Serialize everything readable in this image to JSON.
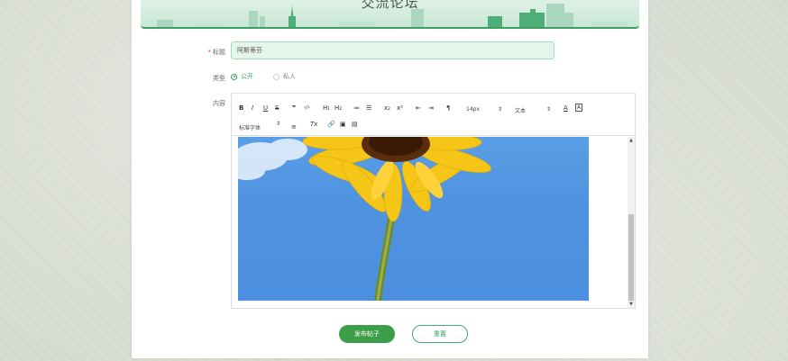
{
  "banner": {
    "title": "交流论坛"
  },
  "form": {
    "title_label": "标题",
    "required_mark": "*",
    "title_value": "阿斯蒂芬",
    "type_label": "类型",
    "type_options": [
      {
        "label": "公开",
        "checked": true
      },
      {
        "label": "私人",
        "checked": false
      }
    ],
    "content_label": "内容"
  },
  "toolbar": {
    "bold": "B",
    "italic": "I",
    "underline": "U",
    "strike": "S",
    "quote": "❞",
    "code": "‹/›",
    "h1": "H₁",
    "h2": "H₂",
    "ol": "≔",
    "ul": "☰",
    "sub": "x₂",
    "sup": "x²",
    "outdent": "⇤",
    "indent": "⇥",
    "rtl": "¶",
    "font_size": "14px",
    "block_format": "文本",
    "font_color": "A",
    "bg_color": "A",
    "font_family": "标准字体",
    "align": "≡",
    "clear_format": "Tx",
    "link": "🔗",
    "image": "▣",
    "video": "▤"
  },
  "buttons": {
    "submit": "发布帖子",
    "reset": "重置"
  },
  "colors": {
    "accent": "#3d9e4a",
    "banner_border": "#3d9e62",
    "sky": "#4f93e0"
  }
}
